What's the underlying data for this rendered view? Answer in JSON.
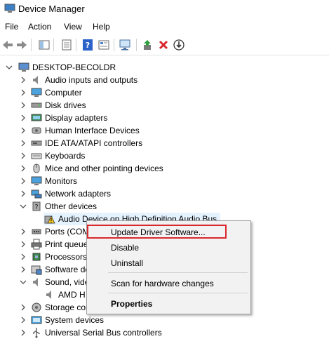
{
  "window": {
    "title": "Device Manager"
  },
  "menu": [
    "File",
    "Action",
    "View",
    "Help"
  ],
  "tree": {
    "root": "DESKTOP-BECOLDR",
    "items": [
      "Audio inputs and outputs",
      "Computer",
      "Disk drives",
      "Display adapters",
      "Human Interface Devices",
      "IDE ATA/ATAPI controllers",
      "Keyboards",
      "Mice and other pointing devices",
      "Monitors",
      "Network adapters",
      "Other devices",
      "Audio Device on High Definition Audio Bus",
      "Ports (COM",
      "Print queue",
      "Processors",
      "Software de",
      "Sound, vide",
      "AMD H",
      "Storage con",
      "System devices",
      "Universal Serial Bus controllers"
    ]
  },
  "context_menu": {
    "items": [
      "Update Driver Software...",
      "Disable",
      "Uninstall",
      "Scan for hardware changes",
      "Properties"
    ]
  },
  "colors": {
    "highlight_border": "#d9272e",
    "menu_bg": "#f2f2f2",
    "selection": "#e5f3ff"
  }
}
